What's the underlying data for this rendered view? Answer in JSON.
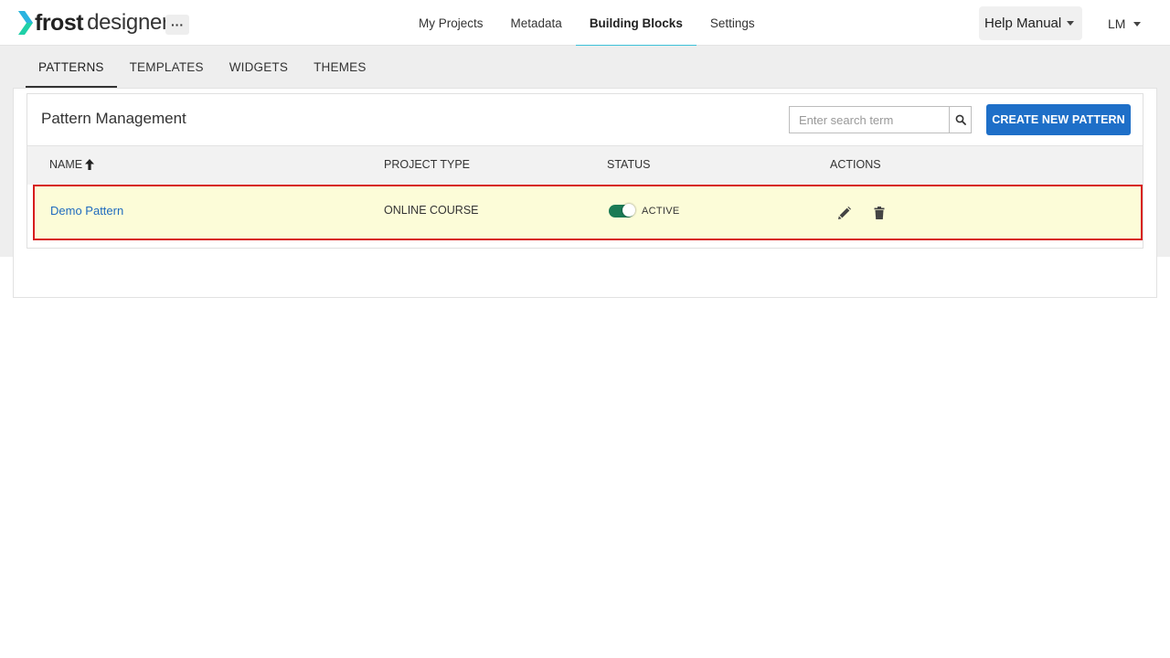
{
  "app": {
    "logo_frost": "frost",
    "logo_designer": "designer",
    "more_label": "···"
  },
  "nav": {
    "items": [
      {
        "label": "My Projects"
      },
      {
        "label": "Metadata"
      },
      {
        "label": "Building Blocks"
      },
      {
        "label": "Settings"
      }
    ],
    "help_label": "Help Manual",
    "user_initials": "LM"
  },
  "tabs": [
    {
      "label": "PATTERNS"
    },
    {
      "label": "TEMPLATES"
    },
    {
      "label": "WIDGETS"
    },
    {
      "label": "THEMES"
    }
  ],
  "card": {
    "title": "Pattern Management",
    "search_placeholder": "Enter search term",
    "create_label": "CREATE NEW PATTERN"
  },
  "table": {
    "headers": {
      "name": "NAME",
      "project_type": "PROJECT TYPE",
      "status": "STATUS",
      "actions": "ACTIONS"
    },
    "rows": [
      {
        "name": "Demo Pattern",
        "project_type": "ONLINE COURSE",
        "status": "ACTIVE"
      }
    ]
  },
  "colors": {
    "accent": "#3cc0d8",
    "primary_button": "#1e6fc8",
    "link": "#1f6bbf",
    "toggle_on": "#1a7a55",
    "row_highlight": "#fcfcd8",
    "highlight_border": "#d71d1d"
  }
}
